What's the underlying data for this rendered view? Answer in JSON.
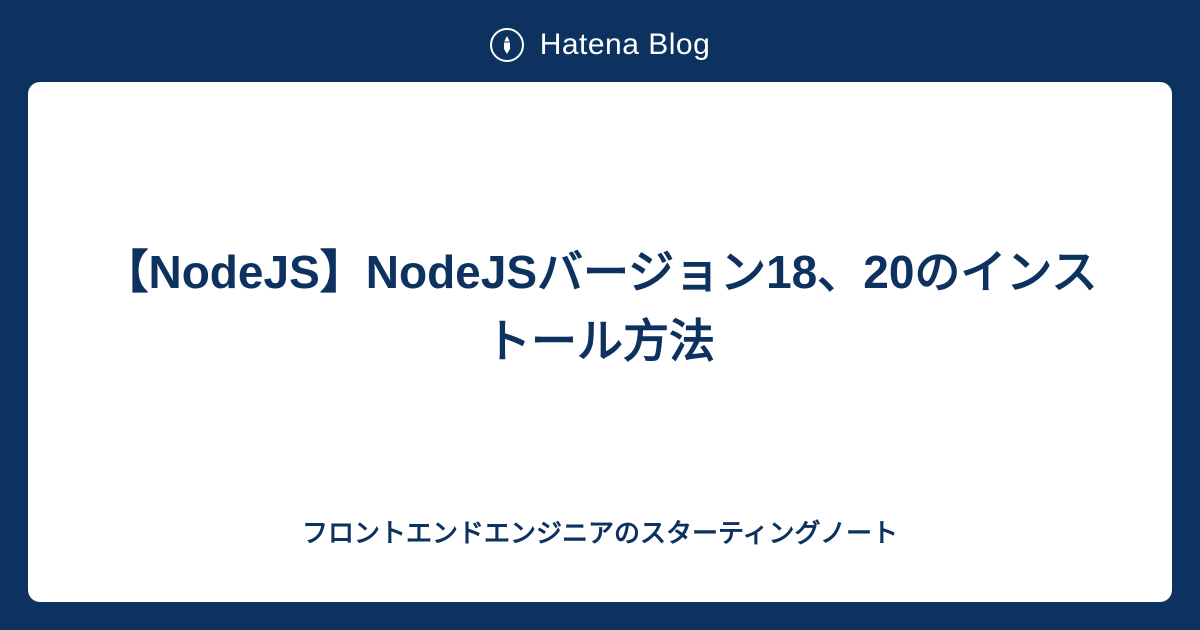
{
  "header": {
    "logo_text": "Hatena Blog"
  },
  "card": {
    "article_title": "【NodeJS】NodeJSバージョン18、20のインストール方法",
    "blog_name": "フロントエンドエンジニアのスターティングノート"
  }
}
